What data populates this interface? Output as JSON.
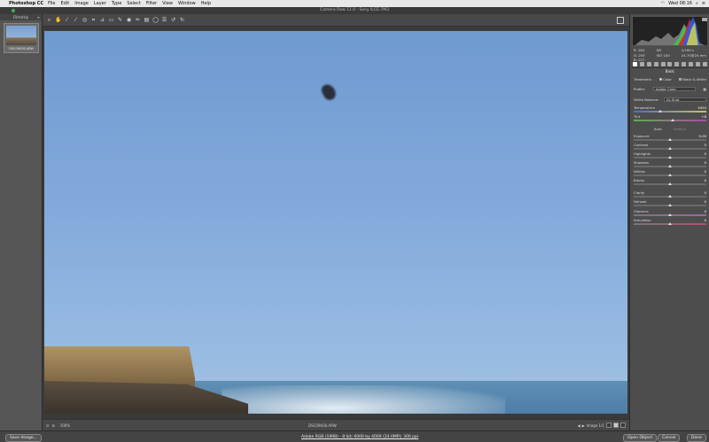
{
  "menubar": {
    "app_name": "Photoshop CC",
    "items": [
      "File",
      "Edit",
      "Image",
      "Layer",
      "Type",
      "Select",
      "Filter",
      "View",
      "Window",
      "Help"
    ],
    "clock": "Wed 08:16"
  },
  "window": {
    "title": "Camera Raw 11.0 - Sony ILCE-7M3"
  },
  "filmstrip": {
    "header": "Filmstrip",
    "thumbnail_name": "DSC09036.ARW"
  },
  "status": {
    "zoom": "100%",
    "filename": "DSC09036.ARW",
    "image_count": "Image 1/1"
  },
  "bottom": {
    "save_label": "Save Image...",
    "workflow_link": "Adobe RGB (1998) - 8 bit; 6000 by 4000 (24.0MP); 300 ppi",
    "open_label": "Open Object",
    "cancel_label": "Cancel",
    "done_label": "Done"
  },
  "histogram": {
    "r": "R: 184",
    "g": "G: 205",
    "b": "B: 227",
    "aperture": "f/8",
    "shutter": "1/160 s",
    "iso": "ISO 100",
    "lens": "24-70@24 mm"
  },
  "basic": {
    "title": "Basic",
    "treatment_label": "Treatment:",
    "color_label": "Color",
    "bw_label": "Black & White",
    "profile_label": "Profile:",
    "profile_value": "Adobe Color",
    "wb_label": "White Balance:",
    "wb_value": "As Shot",
    "auto_label": "Auto",
    "default_label": "Default",
    "sliders": [
      {
        "label": "Temperature",
        "value": "4450"
      },
      {
        "label": "Tint",
        "value": "+8"
      },
      {
        "label": "Exposure",
        "value": "0.00"
      },
      {
        "label": "Contrast",
        "value": "0"
      },
      {
        "label": "Highlights",
        "value": "0"
      },
      {
        "label": "Shadows",
        "value": "0"
      },
      {
        "label": "Whites",
        "value": "0"
      },
      {
        "label": "Blacks",
        "value": "0"
      },
      {
        "label": "Clarity",
        "value": "0"
      },
      {
        "label": "Dehaze",
        "value": "0"
      },
      {
        "label": "Vibrance",
        "value": "0"
      },
      {
        "label": "Saturation",
        "value": "0"
      }
    ]
  },
  "colors": {
    "panel_bg": "#4d4d4d",
    "sky": "#82a9db",
    "accent": "#39b54a"
  }
}
